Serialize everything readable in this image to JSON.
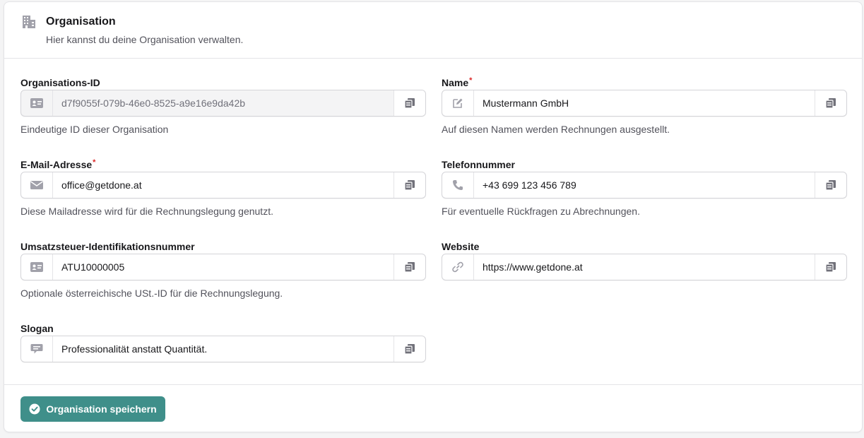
{
  "header": {
    "title": "Organisation",
    "subtitle": "Hier kannst du deine Organisation verwalten.",
    "icon": "building-icon"
  },
  "fields": {
    "org_id": {
      "label": "Organisations-ID",
      "required": false,
      "value": "d7f9055f-079b-46e0-8525-a9e16e9da42b",
      "hint": "Eindeutige ID dieser Organisation",
      "icon": "id-card-icon",
      "readonly": true
    },
    "name": {
      "label": "Name",
      "required": true,
      "value": "Mustermann GmbH",
      "hint": "Auf diesen Namen werden Rechnungen ausgestellt.",
      "icon": "edit-icon"
    },
    "email": {
      "label": "E-Mail-Adresse",
      "required": true,
      "value": "office@getdone.at",
      "hint": "Diese Mailadresse wird für die Rechnungslegung genutzt.",
      "icon": "envelope-icon"
    },
    "phone": {
      "label": "Telefonnummer",
      "required": false,
      "value": "+43 699 123 456 789",
      "hint": "Für eventuelle Rückfragen zu Abrechnungen.",
      "icon": "phone-icon"
    },
    "vat": {
      "label": "Umsatzsteuer-Identifikationsnummer",
      "required": false,
      "value": "ATU10000005",
      "hint": "Optionale österreichische USt.-ID für die Rechnungslegung.",
      "icon": "id-card-icon"
    },
    "website": {
      "label": "Website",
      "required": false,
      "value": "https://www.getdone.at",
      "hint": "",
      "icon": "link-icon"
    },
    "slogan": {
      "label": "Slogan",
      "required": false,
      "value": "Professionalität anstatt Quantität.",
      "hint": "",
      "icon": "chat-bubble-icon"
    }
  },
  "required_marker": "*",
  "copy_icon": "copy-icon",
  "footer": {
    "save_label": "Organisation speichern",
    "save_icon": "check-circle-icon"
  },
  "colors": {
    "primary": "#3f8f8a",
    "required": "#dc2626",
    "border": "#d4d4d8",
    "muted_text": "#52525b"
  }
}
